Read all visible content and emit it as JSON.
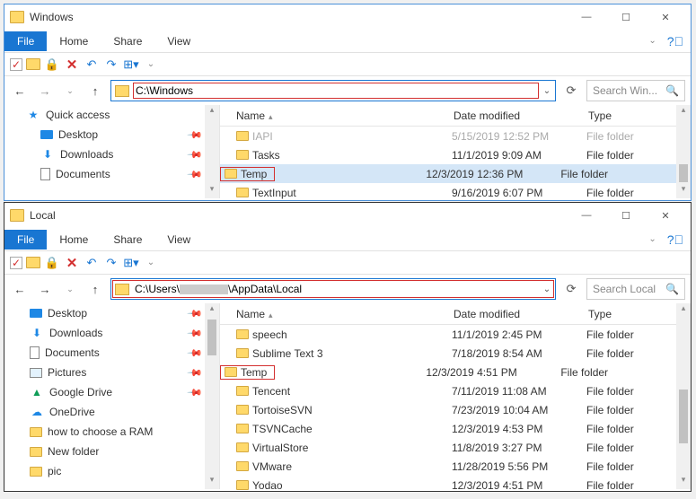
{
  "win1": {
    "title": "Windows",
    "ribbon": {
      "file": "File",
      "tabs": [
        "Home",
        "Share",
        "View"
      ]
    },
    "address": "C:\\Windows",
    "search_placeholder": "Search Win...",
    "columns": {
      "name": "Name",
      "date": "Date modified",
      "type": "Type"
    },
    "sidebar": [
      {
        "icon": "star",
        "label": "Quick access",
        "pin": false
      },
      {
        "icon": "desktop",
        "label": "Desktop",
        "pin": true
      },
      {
        "icon": "dl",
        "label": "Downloads",
        "pin": true
      },
      {
        "icon": "doc",
        "label": "Documents",
        "pin": true
      }
    ],
    "rows": [
      {
        "name": "IAPI",
        "date": "5/15/2019 12:52 PM",
        "type": "File folder",
        "dim": true
      },
      {
        "name": "Tasks",
        "date": "11/1/2019 9:09 AM",
        "type": "File folder"
      },
      {
        "name": "Temp",
        "date": "12/3/2019 12:36 PM",
        "type": "File folder",
        "sel": true,
        "hl": true
      },
      {
        "name": "TextInput",
        "date": "9/16/2019 6:07 PM",
        "type": "File folder"
      }
    ]
  },
  "win2": {
    "title": "Local",
    "ribbon": {
      "file": "File",
      "tabs": [
        "Home",
        "Share",
        "View"
      ]
    },
    "address_prefix": "C:\\Users\\",
    "address_suffix": "\\AppData\\Local",
    "search_placeholder": "Search Local",
    "columns": {
      "name": "Name",
      "date": "Date modified",
      "type": "Type"
    },
    "sidebar": [
      {
        "icon": "desktop",
        "label": "Desktop",
        "pin": true
      },
      {
        "icon": "dl",
        "label": "Downloads",
        "pin": true
      },
      {
        "icon": "doc",
        "label": "Documents",
        "pin": true
      },
      {
        "icon": "pic",
        "label": "Pictures",
        "pin": true
      },
      {
        "icon": "gdrive",
        "label": "Google Drive",
        "pin": true
      },
      {
        "icon": "onedrive",
        "label": "OneDrive",
        "pin": false
      },
      {
        "icon": "fold",
        "label": "how to choose a RAM",
        "pin": false
      },
      {
        "icon": "fold",
        "label": "New folder",
        "pin": false
      },
      {
        "icon": "fold",
        "label": "pic",
        "pin": false
      }
    ],
    "rows": [
      {
        "name": "speech",
        "date": "11/1/2019 2:45 PM",
        "type": "File folder"
      },
      {
        "name": "Sublime Text 3",
        "date": "7/18/2019 8:54 AM",
        "type": "File folder"
      },
      {
        "name": "Temp",
        "date": "12/3/2019 4:51 PM",
        "type": "File folder",
        "hl": true
      },
      {
        "name": "Tencent",
        "date": "7/11/2019 11:08 AM",
        "type": "File folder"
      },
      {
        "name": "TortoiseSVN",
        "date": "7/23/2019 10:04 AM",
        "type": "File folder"
      },
      {
        "name": "TSVNCache",
        "date": "12/3/2019 4:53 PM",
        "type": "File folder"
      },
      {
        "name": "VirtualStore",
        "date": "11/8/2019 3:27 PM",
        "type": "File folder"
      },
      {
        "name": "VMware",
        "date": "11/28/2019 5:56 PM",
        "type": "File folder"
      },
      {
        "name": "Yodao",
        "date": "12/3/2019 4:51 PM",
        "type": "File folder"
      }
    ]
  }
}
